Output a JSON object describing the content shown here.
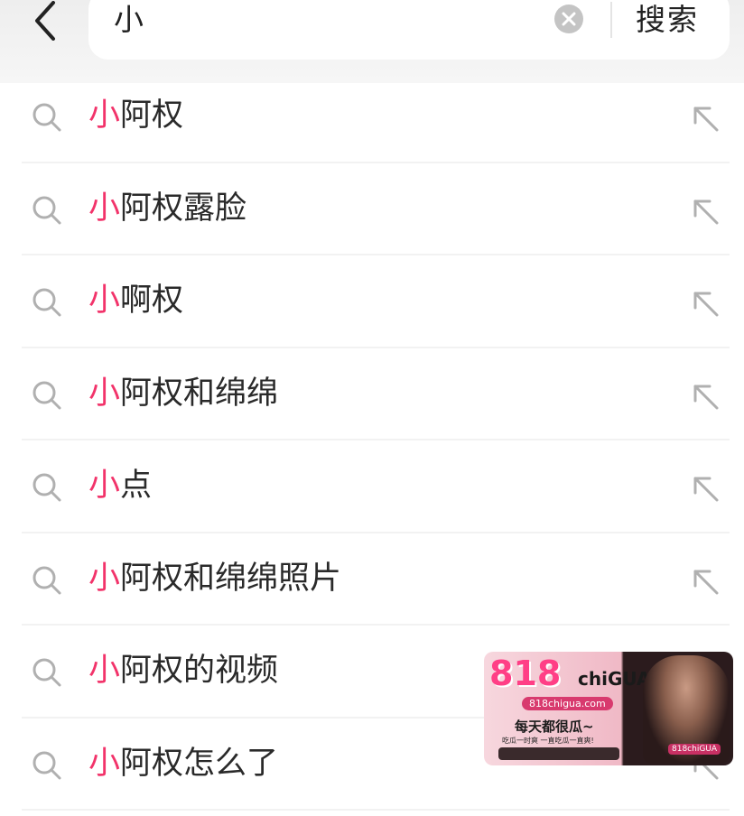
{
  "header": {
    "query": "小",
    "search_label": "搜索"
  },
  "suggestions": [
    {
      "highlight": "小",
      "rest": "阿权"
    },
    {
      "highlight": "小",
      "rest": "阿权露脸"
    },
    {
      "highlight": "小",
      "rest": "啊权"
    },
    {
      "highlight": "小",
      "rest": "阿权和绵绵"
    },
    {
      "highlight": "小",
      "rest": "点"
    },
    {
      "highlight": "小",
      "rest": "阿权和绵绵照片"
    },
    {
      "highlight": "小",
      "rest": "阿权的视频"
    },
    {
      "highlight": "小",
      "rest": "阿权怎么了"
    }
  ],
  "ad": {
    "logo": "818",
    "brand": "chiGUA",
    "url": "818chigua.com",
    "slogan": "每天都很瓜~",
    "sub": "吃瓜一时爽 一直吃瓜一直爽!",
    "tag": "818chiGUA"
  },
  "colors": {
    "highlight": "#f2336a",
    "icon": "#b0b0b0"
  },
  "icons": {
    "back": "chevron-left-icon",
    "clear": "clear-circle-icon",
    "row_search": "search-icon",
    "row_fill": "arrow-up-left-icon"
  }
}
